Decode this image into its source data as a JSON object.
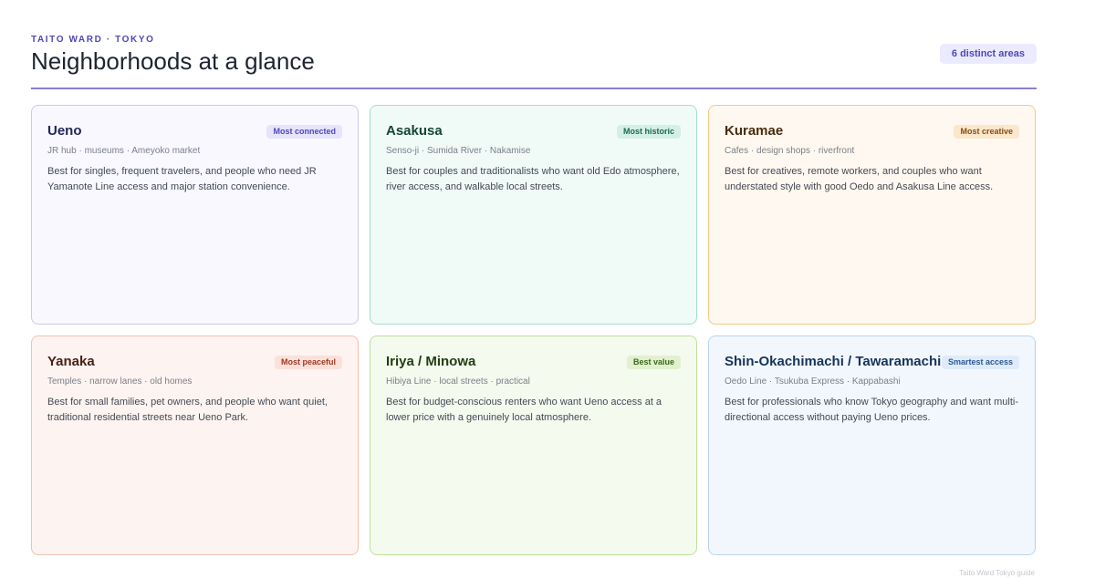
{
  "header": {
    "eyebrow": "TAITO WARD · TOKYO",
    "title": "Neighborhoods at a glance",
    "count_badge": "6 distinct areas"
  },
  "neighborhoods": [
    {
      "name": "Ueno",
      "badge": "Most connected",
      "tags": "JR hub · museums · Ameyoko market",
      "description": "Best for singles, frequent travelers, and people who need JR Yamanote Line access and major station convenience.",
      "theme_color": "#4f48b7"
    },
    {
      "name": "Asakusa",
      "badge": "Most historic",
      "tags": "Senso-ji · Sumida River · Nakamise",
      "description": "Best for couples and traditionalists who want old Edo atmosphere, river access, and walkable local streets.",
      "theme_color": "#1b6b52"
    },
    {
      "name": "Kuramae",
      "badge": "Most creative",
      "tags": "Cafes · design shops · riverfront",
      "description": "Best for creatives, remote workers, and couples who want understated style with good Oedo and Asakusa Line access.",
      "theme_color": "#8a4b10"
    },
    {
      "name": "Yanaka",
      "badge": "Most peaceful",
      "tags": "Temples · narrow lanes · old homes",
      "description": "Best for small families, pet owners, and people who want quiet, traditional residential streets near Ueno Park.",
      "theme_color": "#a03a22"
    },
    {
      "name": "Iriya / Minowa",
      "badge": "Best value",
      "tags": "Hibiya Line · local streets · practical",
      "description": "Best for budget-conscious renters who want Ueno access at a lower price with a genuinely local atmosphere.",
      "theme_color": "#3d6a18"
    },
    {
      "name": "Shin-Okachimachi / Tawaramachi",
      "badge": "Smartest access",
      "tags": "Oedo Line · Tsukuba Express · Kappabashi",
      "description": "Best for professionals who know Tokyo geography and want multi-directional access without paying Ueno prices.",
      "theme_color": "#2b5a98"
    }
  ],
  "footer": {
    "note": "Taito Ward Tokyo guide"
  }
}
